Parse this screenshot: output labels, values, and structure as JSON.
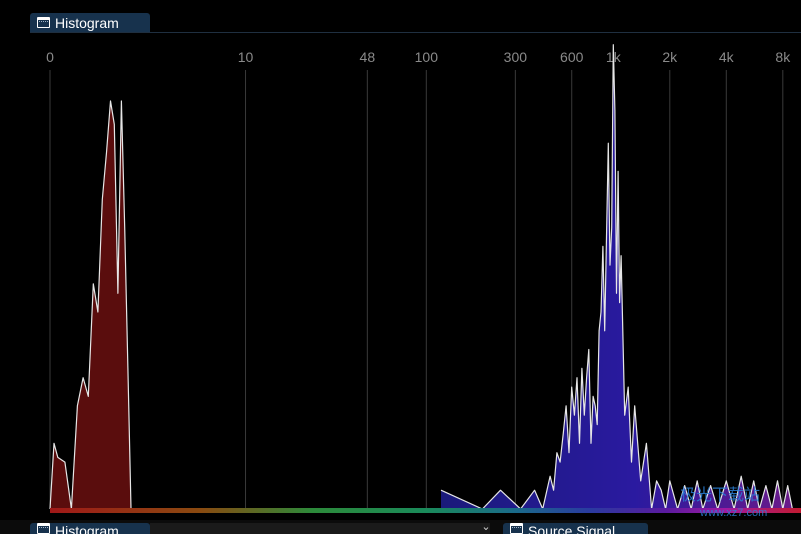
{
  "panels": {
    "top_tab": {
      "label": "Histogram",
      "icon": "window-icon"
    },
    "bottom_left_tab": {
      "label": "Histogram",
      "icon": "window-icon"
    },
    "bottom_right_tab": {
      "label": "Source Signal",
      "icon": "window-icon"
    },
    "collapse_glyph": "⌄"
  },
  "watermark": {
    "text": "www.xz7.com"
  },
  "colors": {
    "background": "#000000",
    "tab_bg": "#17324d",
    "gridline": "#3a3a3a",
    "curve": "#e6e6e6",
    "left_fill": "#5a0d0d",
    "right_fill": "#2a1070"
  },
  "chart_data": {
    "type": "area",
    "title": "",
    "xlabel": "",
    "ylabel": "",
    "x_scale": "log",
    "tick_labels": [
      "0",
      "10",
      "48",
      "100",
      "300",
      "600",
      "1k",
      "2k",
      "4k",
      "8k"
    ],
    "tick_values": [
      0,
      10,
      48,
      100,
      300,
      600,
      1000,
      2000,
      4000,
      8000
    ],
    "ylim": [
      0,
      1
    ],
    "grid": true,
    "series": [
      {
        "x": [
          0,
          0.05,
          0.1,
          0.2,
          0.3,
          0.4,
          0.5,
          0.6,
          0.7,
          0.8,
          0.9,
          1.0,
          1.1,
          1.2,
          1.3,
          1.4,
          1.5,
          1.6,
          1.7,
          1.8,
          1.9,
          2.0,
          2.1,
          2.2,
          2.3,
          2.4
        ],
        "y": [
          0.0,
          0.14,
          0.11,
          0.1,
          0.0,
          0.22,
          0.28,
          0.24,
          0.48,
          0.42,
          0.66,
          0.76,
          0.87,
          0.82,
          0.46,
          0.87,
          0.6,
          0.3,
          0.0,
          0.0,
          0.0,
          0.0,
          0.0,
          0.0,
          0.0,
          0.0
        ]
      },
      {
        "x": [
          120,
          200,
          250,
          320,
          380,
          420,
          460,
          480,
          500,
          520,
          540,
          560,
          580,
          600,
          620,
          640,
          660,
          680,
          700,
          720,
          740,
          760,
          780,
          800,
          820,
          840,
          860,
          880,
          900,
          920,
          940,
          960,
          980,
          1000,
          1020,
          1040,
          1060,
          1080,
          1100,
          1150,
          1200,
          1250,
          1300,
          1400,
          1500,
          1600,
          1700,
          1800,
          1900,
          2000,
          2200,
          2400,
          2600,
          2800,
          3000,
          3300,
          3600,
          4000,
          4400,
          4800,
          5200,
          5600,
          6000,
          6500,
          7000,
          7500,
          8000,
          8500,
          9000
        ],
        "y": [
          0.04,
          0.0,
          0.04,
          0.0,
          0.04,
          0.0,
          0.07,
          0.04,
          0.12,
          0.1,
          0.16,
          0.22,
          0.12,
          0.26,
          0.2,
          0.28,
          0.14,
          0.3,
          0.2,
          0.28,
          0.34,
          0.14,
          0.24,
          0.22,
          0.18,
          0.38,
          0.42,
          0.56,
          0.38,
          0.58,
          0.78,
          0.52,
          0.6,
          0.99,
          0.85,
          0.46,
          0.72,
          0.44,
          0.54,
          0.2,
          0.26,
          0.1,
          0.22,
          0.06,
          0.14,
          0.0,
          0.06,
          0.04,
          0.0,
          0.06,
          0.0,
          0.05,
          0.0,
          0.06,
          0.0,
          0.05,
          0.0,
          0.06,
          0.0,
          0.07,
          0.0,
          0.06,
          0.0,
          0.05,
          0.0,
          0.06,
          0.0,
          0.05,
          0.0
        ]
      }
    ]
  }
}
